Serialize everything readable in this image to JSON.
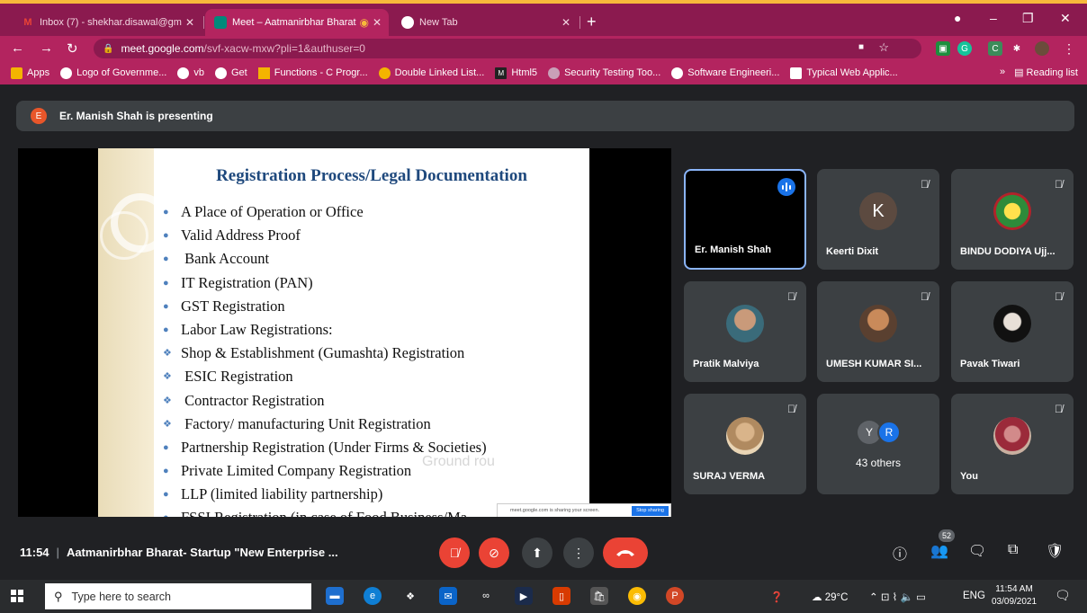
{
  "browser": {
    "tabs": [
      {
        "title": "Inbox (7) - shekhar.disawal@gm",
        "icon": "gmail-icon"
      },
      {
        "title": "Meet – Aatmanirbhar Bharat",
        "icon": "meet-icon"
      },
      {
        "title": "New Tab",
        "icon": "chrome-icon"
      }
    ],
    "url_host": "meet.google.com",
    "url_path": "/svf-xacw-mxw?pli=1&authuser=0",
    "bookmarks": [
      "Apps",
      "Logo of Governme...",
      "vb",
      "Get",
      "Functions - C Progr...",
      "Double Linked List...",
      "Html5",
      "Security Testing Too...",
      "Software Engineeri...",
      "Typical Web Applic..."
    ],
    "bookmarks_more": "»",
    "reading_list": "Reading list"
  },
  "meet": {
    "presenter_initial": "E",
    "presenting_text": "Er. Manish Shah is presenting",
    "slide": {
      "title": "Registration Process/Legal Documentation",
      "items": [
        {
          "marker": "dot",
          "text": "A Place of Operation or Office"
        },
        {
          "marker": "dot",
          "text": "Valid Address Proof"
        },
        {
          "marker": "dot",
          "text": " Bank Account"
        },
        {
          "marker": "dot",
          "text": "IT Registration (PAN)"
        },
        {
          "marker": "dot",
          "text": "GST Registration"
        },
        {
          "marker": "dot",
          "text": "Labor Law Registrations:"
        },
        {
          "marker": "diamond",
          "text": "Shop & Establishment (Gumashta) Registration"
        },
        {
          "marker": "diamond",
          "text": " ESIC Registration"
        },
        {
          "marker": "diamond",
          "text": " Contractor Registration"
        },
        {
          "marker": "diamond",
          "text": " Factory/ manufacturing Unit Registration"
        },
        {
          "marker": "dot",
          "text": "Partnership Registration (Under Firms & Societies)"
        },
        {
          "marker": "dot",
          "text": "Private Limited Company Registration"
        },
        {
          "marker": "dot",
          "text": "LLP (limited liability partnership)"
        },
        {
          "marker": "dot",
          "text": "FSSI Registration (in case of Food Business/Ma"
        }
      ],
      "ghost_text": "Ground rou",
      "share_notice": "meet.google.com is sharing your screen.",
      "stop_sharing": "Stop sharing"
    },
    "participants": [
      {
        "name": "Er. Manish Shah",
        "speaking": true
      },
      {
        "name": "Keerti Dixit",
        "initial": "K",
        "muted": true
      },
      {
        "name": "BINDU DODIYA Ujj...",
        "muted": true
      },
      {
        "name": "Pratik Malviya",
        "muted": true
      },
      {
        "name": "UMESH KUMAR SI...",
        "muted": true
      },
      {
        "name": "Pavak Tiwari",
        "muted": true
      },
      {
        "name": "SURAJ VERMA",
        "muted": true
      },
      {
        "name": "You",
        "muted": true
      }
    ],
    "others": {
      "label": "43 others",
      "initials": [
        "Y",
        "R"
      ]
    },
    "time": "11:54",
    "meeting_title": "Aatmanirbhar Bharat- Startup \"New Enterprise ...",
    "people_count": "52"
  },
  "taskbar": {
    "search_placeholder": "Type here to search",
    "weather": "29°C",
    "language": "ENG",
    "time": "11:54 AM",
    "date": "03/09/2021"
  },
  "colors": {
    "chrome_frame": "#8b1a4f",
    "chrome_toolbar": "#b3245f",
    "meet_bg": "#202124",
    "tile_bg": "#3c4043",
    "red_button": "#ea4335",
    "slide_title": "#1f497d"
  }
}
